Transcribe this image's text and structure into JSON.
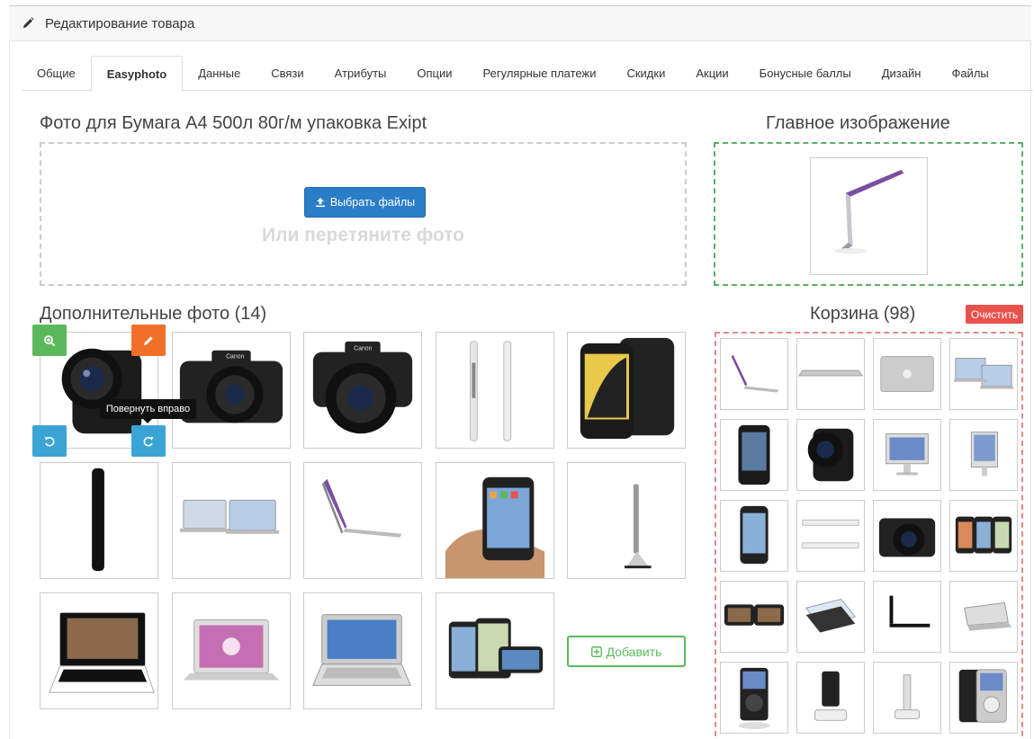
{
  "header": {
    "title": "Редактирование товара",
    "icon": "pencil-icon"
  },
  "tabs": [
    {
      "label": "Общие",
      "active": false
    },
    {
      "label": "Easyphoto",
      "active": true
    },
    {
      "label": "Данные",
      "active": false
    },
    {
      "label": "Связи",
      "active": false
    },
    {
      "label": "Атрибуты",
      "active": false
    },
    {
      "label": "Опции",
      "active": false
    },
    {
      "label": "Регулярные платежи",
      "active": false
    },
    {
      "label": "Скидки",
      "active": false
    },
    {
      "label": "Акции",
      "active": false
    },
    {
      "label": "Бонусные баллы",
      "active": false
    },
    {
      "label": "Дизайн",
      "active": false
    },
    {
      "label": "Файлы",
      "active": false
    }
  ],
  "upload": {
    "title": "Фото для Бумага А4 500л 80г/м упаковка Exipt",
    "button_label": "Выбрать файлы",
    "drop_hint": "Или перетяните фото"
  },
  "main_image": {
    "title": "Главное изображение",
    "image": "laptop-side"
  },
  "additional": {
    "title": "Дополнительные фото (14)",
    "tooltip": "Повернуть вправо",
    "add_label": "Добавить",
    "photos": [
      "camera-side",
      "camera-front",
      "camera-lens",
      "phone-sides",
      "phone-dark",
      "phone-slim",
      "laptops-pair",
      "laptop-side",
      "iphone-hand",
      "imac-side",
      "laptop-black",
      "laptop-silver",
      "laptop-blue",
      "iphones-group"
    ]
  },
  "basket": {
    "title": "Корзина (98)",
    "clear_label": "Очистить",
    "photos": [
      "laptop-side",
      "laptop-flat",
      "laptop-lid",
      "laptops-pair",
      "phone-dark",
      "camera-side",
      "imac-front",
      "imac-side",
      "iphone",
      "phone-sides",
      "camera-front",
      "iphones-group",
      "phone-landscape",
      "phone-layers",
      "laptop-black-side",
      "laptop-open",
      "ipod-black",
      "ipod-dock",
      "dock",
      "ipod-classic"
    ]
  },
  "colors": {
    "primary": "#2a7dc7",
    "success": "#5cb85c",
    "danger": "#e9514c",
    "warning": "#f0702a",
    "info": "#3aa5d4"
  }
}
